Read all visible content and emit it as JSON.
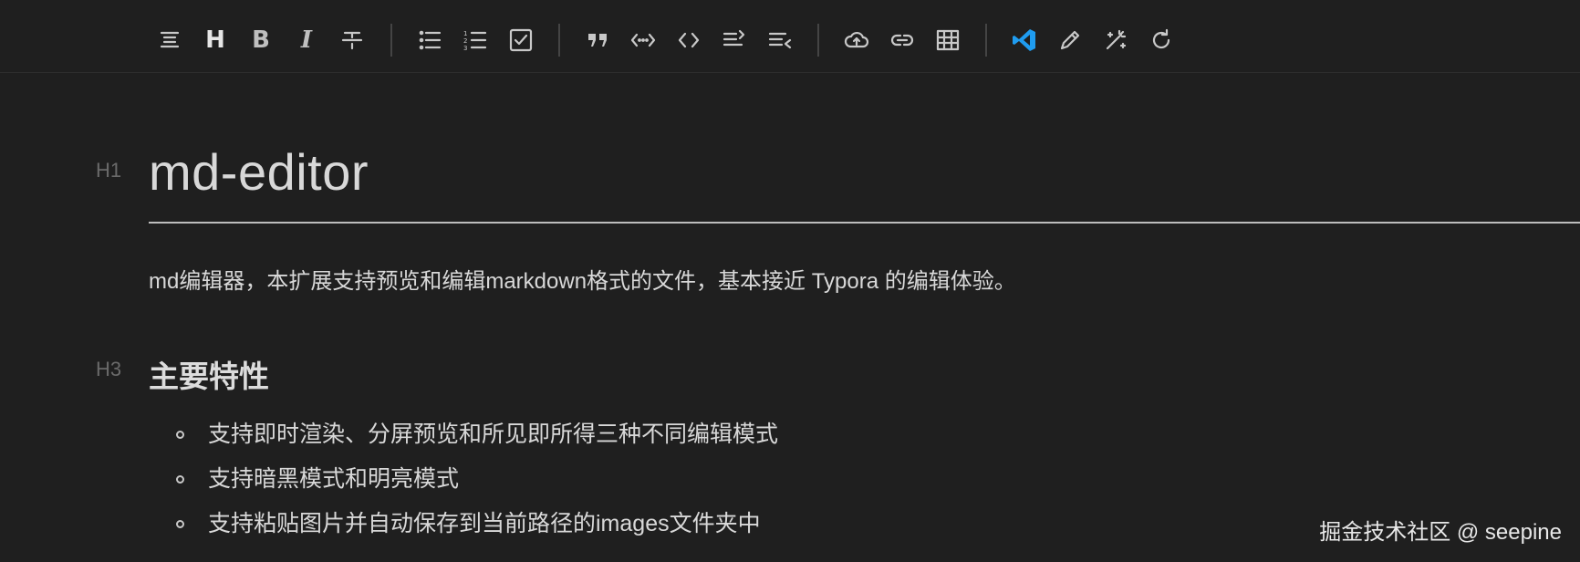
{
  "toolbar": {
    "buttons": [
      {
        "name": "format-icon"
      },
      {
        "name": "heading-button",
        "label": "H"
      },
      {
        "name": "bold-button",
        "label": "B"
      },
      {
        "name": "italic-button",
        "label": "I"
      },
      {
        "name": "strikethrough-icon"
      },
      {
        "name": "bullet-list-icon"
      },
      {
        "name": "numbered-list-icon"
      },
      {
        "name": "checkbox-icon"
      },
      {
        "name": "quote-icon"
      },
      {
        "name": "inline-code-icon"
      },
      {
        "name": "code-block-icon"
      },
      {
        "name": "indent-icon"
      },
      {
        "name": "outdent-icon"
      },
      {
        "name": "upload-icon"
      },
      {
        "name": "link-icon"
      },
      {
        "name": "table-icon"
      },
      {
        "name": "vscode-icon"
      },
      {
        "name": "edit-icon"
      },
      {
        "name": "magic-icon"
      },
      {
        "name": "refresh-icon"
      }
    ],
    "accent": "#1f9cf0"
  },
  "document": {
    "h1_marker": "H1",
    "title": "md-editor",
    "paragraph": "md编辑器，本扩展支持预览和编辑markdown格式的文件，基本接近 Typora 的编辑体验。",
    "h3_marker": "H3",
    "section_title": "主要特性",
    "features": [
      "支持即时渲染、分屏预览和所见即所得三种不同编辑模式",
      "支持暗黑模式和明亮模式",
      "支持粘贴图片并自动保存到当前路径的images文件夹中"
    ]
  },
  "watermark": "掘金技术社区 @ seepine"
}
